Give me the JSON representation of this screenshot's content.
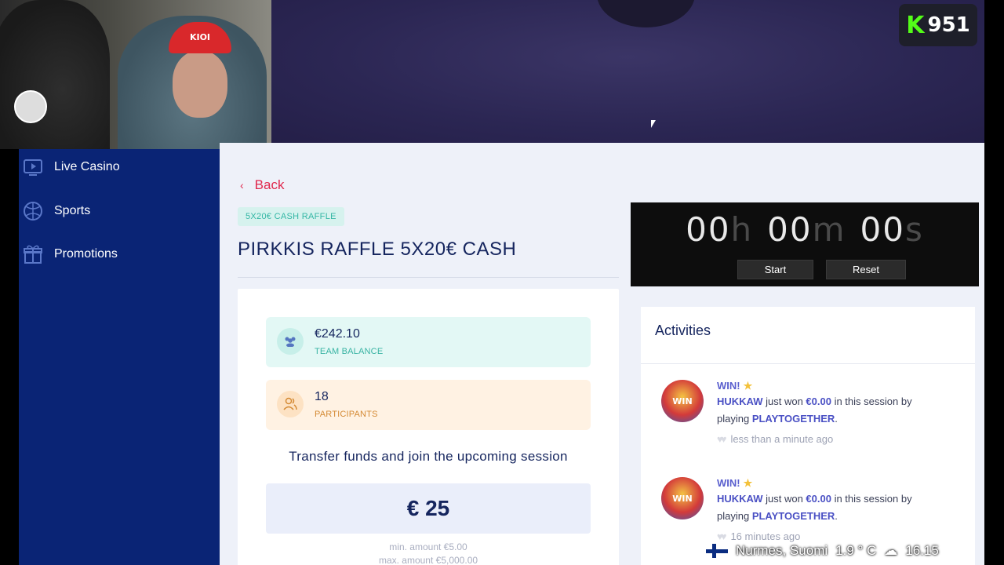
{
  "stream": {
    "kick_logo": "K",
    "viewer_count": "951",
    "webcam_cap_text": "KIOI"
  },
  "sidebar": {
    "items": [
      {
        "label": "Live Casino",
        "icon": "tv-icon"
      },
      {
        "label": "Sports",
        "icon": "ball-icon"
      },
      {
        "label": "Promotions",
        "icon": "gift-icon"
      }
    ]
  },
  "page": {
    "back_label": "Back",
    "tag": "5X20€ CASH RAFFLE",
    "title": "PIRKKIS RAFFLE 5X20€ CASH"
  },
  "stats": {
    "team_balance_value": "€242.10",
    "team_balance_caption": "TEAM BALANCE",
    "participants_value": "18",
    "participants_caption": "PARTICIPANTS"
  },
  "join": {
    "text": "Transfer funds and join the upcoming session",
    "amount": "€ 25",
    "min": "min. amount €5.00",
    "max": "max. amount €5,000.00"
  },
  "timer": {
    "hours": "00",
    "hours_unit": "h",
    "minutes": "00",
    "minutes_unit": "m",
    "seconds": "00",
    "seconds_unit": "s",
    "start_label": "Start",
    "reset_label": "Reset"
  },
  "activities": {
    "title": "Activities",
    "items": [
      {
        "badge": "WIN!",
        "user": "HUKKAW",
        "mid": " just won ",
        "amount": "€0.00",
        "tail": " in this session by",
        "playing": "playing ",
        "game": "PLAYTOGETHER",
        "dot": ".",
        "time": "less than a minute ago"
      },
      {
        "badge": "WIN!",
        "user": "HUKKAW",
        "mid": " just won ",
        "amount": "€0.00",
        "tail": " in this session by",
        "playing": "playing ",
        "game": "PLAYTOGETHER",
        "dot": ".",
        "time": "16 minutes ago"
      }
    ]
  },
  "overlay": {
    "location": "Nurmes, Suomi",
    "temperature": "1.9 ° C",
    "clock": "16.15"
  },
  "colors": {
    "sidebar_bg": "#0a2475",
    "accent_red": "#e0284d",
    "navy_text": "#15255e",
    "kick_green": "#53fc18"
  }
}
